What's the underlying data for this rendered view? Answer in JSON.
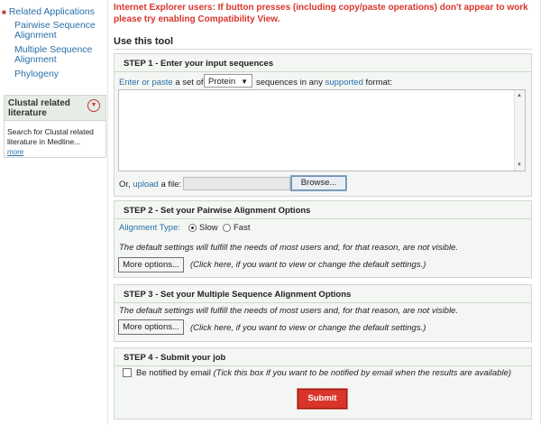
{
  "sidebar": {
    "related_heading": "Related Applications",
    "links": [
      {
        "label": "Pairwise Sequence"
      },
      {
        "label": "Alignment"
      },
      {
        "label": "Multiple Sequence"
      },
      {
        "label": "Alignment"
      },
      {
        "label": "Phylogeny"
      }
    ],
    "box": {
      "title": "Clustal related literature",
      "body": "Search for Clustal related literature in Medline...",
      "more": "more"
    }
  },
  "warning": "Internet Explorer users: If button presses (including copy/paste operations) don't appear to work please try enabling Compatibility View.",
  "use_title": "Use this tool",
  "step1": {
    "title": "STEP 1 - Enter your input sequences",
    "enter": "Enter",
    "or": " or ",
    "paste": "paste",
    "set_of": " a set of",
    "select_value": "Protein",
    "seq_text": "sequences in any",
    "supported": "supported",
    "format": "format:",
    "or_label": "Or,",
    "upload": "upload",
    "a_file": "a file:",
    "browse": "Browse..."
  },
  "step2": {
    "title": "STEP 2 - Set your Pairwise Alignment Options",
    "align_type": "Alignment Type:",
    "slow": "Slow",
    "fast": "Fast",
    "default_note": "The default settings will fulfill the needs of most users and, for that reason, are not visible.",
    "more_options": "More options...",
    "click_note": "(Click here, if you want to view or change the default settings.)"
  },
  "step3": {
    "title": "STEP 3 - Set your Multiple Sequence Alignment Options",
    "default_note": "The default settings will fulfill the needs of most users and, for that reason, are not visible.",
    "more_options": "More options...",
    "click_note": "(Click here, if you want to view or change the default settings.)"
  },
  "step4": {
    "title": "STEP 4 - Submit your job",
    "notify": "Be notified by email",
    "notify_note": "(Tick this box if you want to be notified by email when the results are available)",
    "submit": "Submit"
  },
  "colors": {
    "link": "#2a6fa6",
    "warning": "#d9352a",
    "panel": "#f3f6f3",
    "submit": "#d9352a"
  },
  "icons": {
    "box": "triangle-down-icon",
    "bullet": "square-bullet-icon"
  }
}
